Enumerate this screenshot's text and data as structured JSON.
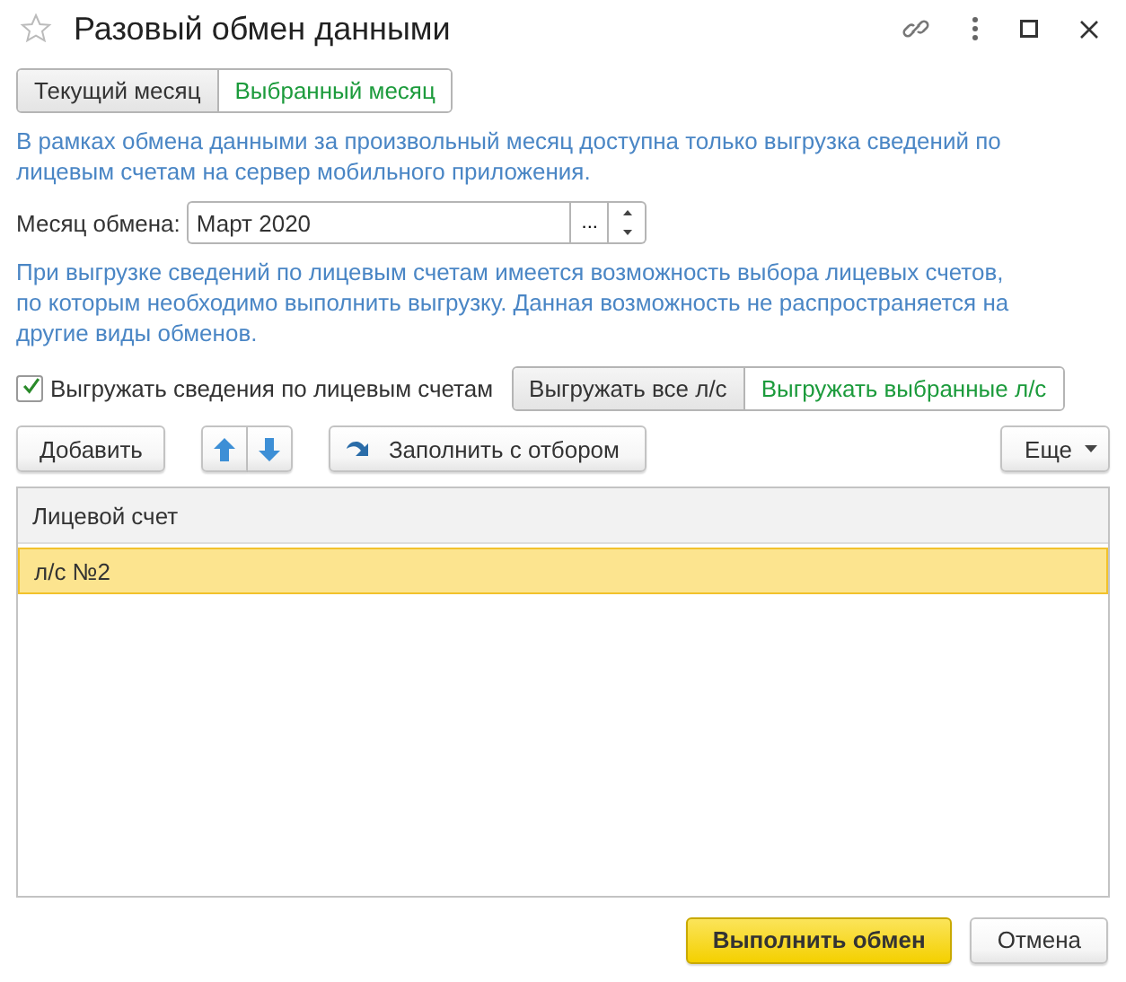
{
  "window": {
    "title": "Разовый обмен данными"
  },
  "period_tabs": [
    {
      "label": "Текущий месяц",
      "selected": false
    },
    {
      "label": "Выбранный месяц",
      "selected": true
    }
  ],
  "info_1": "В рамках обмена данными за произвольный месяц доступна только выгрузка сведений по лицевым счетам на сервер мобильного приложения.",
  "month_field": {
    "label": "Месяц обмена:",
    "value": "Март 2020",
    "choose_button": "..."
  },
  "info_2": "При выгрузке сведений по лицевым счетам имеется возможность выбора лицевых счетов, по которым необходимо выполнить выгрузку. Данная возможность не распространяется на другие виды обменов.",
  "export_checkbox": {
    "label": "Выгружать сведения по лицевым счетам",
    "checked": true
  },
  "export_mode": [
    {
      "label": "Выгружать все л/с",
      "selected": false
    },
    {
      "label": "Выгружать выбранные л/с",
      "selected": true
    }
  ],
  "toolbar": {
    "add": "Добавить",
    "fill": "Заполнить с отбором",
    "more": "Еще"
  },
  "table": {
    "columns": [
      "Лицевой счет"
    ],
    "rows": [
      {
        "cells": [
          "л/с №2"
        ],
        "selected": true
      }
    ]
  },
  "buttons": {
    "primary": "Выполнить обмен",
    "cancel": "Отмена"
  }
}
